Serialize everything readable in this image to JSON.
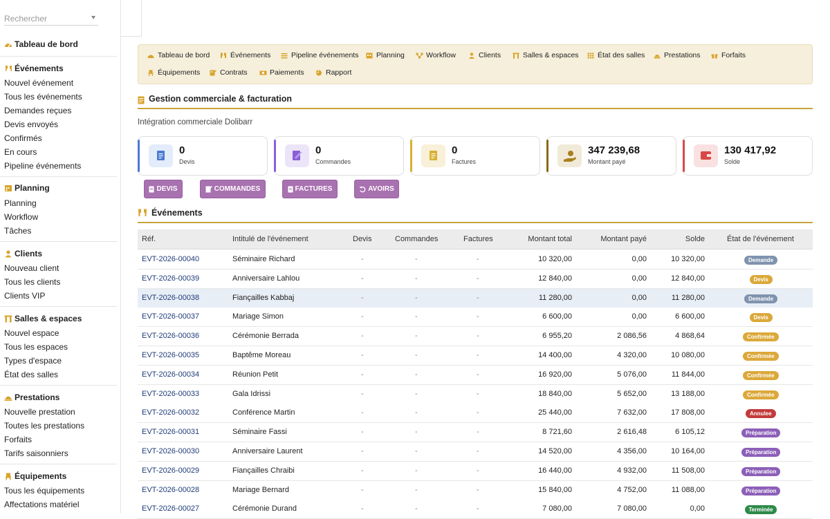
{
  "sidebar": {
    "search_placeholder": "Rechercher",
    "dashboard": "Tableau de bord",
    "sections": {
      "events": {
        "title": "Événements",
        "items": [
          "Nouvel événement",
          "Tous les événements",
          "Demandes reçues",
          "Devis envoyés",
          "Confirmés",
          "En cours",
          "Pipeline événements"
        ]
      },
      "planning": {
        "title": "Planning",
        "items": [
          "Planning",
          "Workflow",
          "Tâches"
        ]
      },
      "clients": {
        "title": "Clients",
        "items": [
          "Nouveau client",
          "Tous les clients",
          "Clients VIP"
        ]
      },
      "rooms": {
        "title": "Salles & espaces",
        "items": [
          "Nouvel espace",
          "Tous les espaces",
          "Types d'espace",
          "État des salles"
        ]
      },
      "services": {
        "title": "Prestations",
        "items": [
          "Nouvelle prestation",
          "Toutes les prestations",
          "Forfaits",
          "Tarifs saisonniers"
        ]
      },
      "equipment": {
        "title": "Équipements",
        "items": [
          "Tous les équipements",
          "Affectations matériel"
        ]
      }
    }
  },
  "nav": {
    "row1": [
      "Tableau de bord",
      "Événements",
      "Pipeline événements",
      "Planning",
      "Workflow",
      "Clients",
      "Salles & espaces",
      "État des salles",
      "Prestations",
      "Forfaits"
    ],
    "row2": [
      "Équipements",
      "Contrats",
      "Paiements",
      "Rapport"
    ]
  },
  "section": {
    "title": "Gestion commerciale & facturation",
    "subtitle": "Intégration commerciale Dolibarr"
  },
  "kpis": [
    {
      "value": "0",
      "label": "Devis",
      "color": "#4a7bd0"
    },
    {
      "value": "0",
      "label": "Commandes",
      "color": "#8b5fd6"
    },
    {
      "value": "0",
      "label": "Factures",
      "color": "#d8b034"
    },
    {
      "value": "347 239,68",
      "label": "Montant payé",
      "color": "#8a6a1a"
    },
    {
      "value": "130 417,92",
      "label": "Solde",
      "color": "#d84848"
    }
  ],
  "buttons": [
    "DEVIS",
    "COMMANDES",
    "FACTURES",
    "AVOIRS"
  ],
  "events_section": {
    "title": "Événements"
  },
  "table": {
    "headers": [
      "Réf.",
      "Intitulé de l'événement",
      "Devis",
      "Commandes",
      "Factures",
      "Montant total",
      "Montant payé",
      "Solde",
      "État de l'événement"
    ],
    "rows": [
      {
        "ref": "EVT-2026-00040",
        "name": "Séminaire Richard",
        "devis": "-",
        "commandes": "-",
        "factures": "-",
        "total": "10 320,00",
        "paye": "0,00",
        "solde": "10 320,00",
        "etat": "Demande"
      },
      {
        "ref": "EVT-2026-00039",
        "name": "Anniversaire Lahlou",
        "devis": "-",
        "commandes": "-",
        "factures": "-",
        "total": "12 840,00",
        "paye": "0,00",
        "solde": "12 840,00",
        "etat": "Devis"
      },
      {
        "ref": "EVT-2026-00038",
        "name": "Fiançailles Kabbaj",
        "devis": "-",
        "commandes": "-",
        "factures": "-",
        "total": "11 280,00",
        "paye": "0,00",
        "solde": "11 280,00",
        "etat": "Demande"
      },
      {
        "ref": "EVT-2026-00037",
        "name": "Mariage Simon",
        "devis": "-",
        "commandes": "-",
        "factures": "-",
        "total": "6 600,00",
        "paye": "0,00",
        "solde": "6 600,00",
        "etat": "Devis"
      },
      {
        "ref": "EVT-2026-00036",
        "name": "Cérémonie Berrada",
        "devis": "-",
        "commandes": "-",
        "factures": "-",
        "total": "6 955,20",
        "paye": "2 086,56",
        "solde": "4 868,64",
        "etat": "Confirmée"
      },
      {
        "ref": "EVT-2026-00035",
        "name": "Baptême Moreau",
        "devis": "-",
        "commandes": "-",
        "factures": "-",
        "total": "14 400,00",
        "paye": "4 320,00",
        "solde": "10 080,00",
        "etat": "Confirmée"
      },
      {
        "ref": "EVT-2026-00034",
        "name": "Réunion Petit",
        "devis": "-",
        "commandes": "-",
        "factures": "-",
        "total": "16 920,00",
        "paye": "5 076,00",
        "solde": "11 844,00",
        "etat": "Confirmée"
      },
      {
        "ref": "EVT-2026-00033",
        "name": "Gala Idrissi",
        "devis": "-",
        "commandes": "-",
        "factures": "-",
        "total": "18 840,00",
        "paye": "5 652,00",
        "solde": "13 188,00",
        "etat": "Confirmée"
      },
      {
        "ref": "EVT-2026-00032",
        "name": "Conférence Martin",
        "devis": "-",
        "commandes": "-",
        "factures": "-",
        "total": "25 440,00",
        "paye": "7 632,00",
        "solde": "17 808,00",
        "etat": "Annulee"
      },
      {
        "ref": "EVT-2026-00031",
        "name": "Séminaire Fassi",
        "devis": "-",
        "commandes": "-",
        "factures": "-",
        "total": "8 721,60",
        "paye": "2 616,48",
        "solde": "6 105,12",
        "etat": "Préparation"
      },
      {
        "ref": "EVT-2026-00030",
        "name": "Anniversaire Laurent",
        "devis": "-",
        "commandes": "-",
        "factures": "-",
        "total": "14 520,00",
        "paye": "4 356,00",
        "solde": "10 164,00",
        "etat": "Préparation"
      },
      {
        "ref": "EVT-2026-00029",
        "name": "Fiançailles Chraibi",
        "devis": "-",
        "commandes": "-",
        "factures": "-",
        "total": "16 440,00",
        "paye": "4 932,00",
        "solde": "11 508,00",
        "etat": "Préparation"
      },
      {
        "ref": "EVT-2026-00028",
        "name": "Mariage Bernard",
        "devis": "-",
        "commandes": "-",
        "factures": "-",
        "total": "15 840,00",
        "paye": "4 752,00",
        "solde": "11 088,00",
        "etat": "Préparation"
      },
      {
        "ref": "EVT-2026-00027",
        "name": "Cérémonie Durand",
        "devis": "-",
        "commandes": "-",
        "factures": "-",
        "total": "7 080,00",
        "paye": "7 080,00",
        "solde": "0,00",
        "etat": "Terminée"
      }
    ]
  },
  "status_colors": {
    "Demande": "#7f93ae",
    "Devis": "#dba83a",
    "Confirmée": "#dba83a",
    "Annulee": "#c23b3b",
    "Préparation": "#8c5fb8",
    "Terminée": "#2e8a4a"
  }
}
